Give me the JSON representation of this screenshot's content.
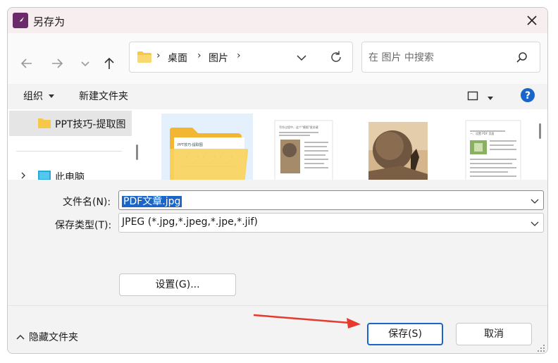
{
  "window": {
    "title": "另存为"
  },
  "nav": {
    "back_icon": "arrow-left-icon",
    "forward_icon": "arrow-right-icon",
    "recent_icon": "chevron-down-icon",
    "up_icon": "arrow-up-icon",
    "breadcrumb": [
      "桌面",
      "图片"
    ],
    "refresh_icon": "refresh-icon"
  },
  "search": {
    "placeholder": "在 图片 中搜索"
  },
  "toolbar": {
    "organize_label": "组织",
    "new_folder_label": "新建文件夹"
  },
  "sidebar": {
    "items": [
      {
        "label": "PPT技巧-提取图",
        "icon": "folder-icon",
        "selected": true
      },
      {
        "label": "此电脑",
        "icon": "computer-icon",
        "selected": false
      }
    ]
  },
  "thumb_text": {
    "card_title": "PPT技巧-提取图",
    "doc1_title": "写作过程中，这个\"模图\"很关键",
    "doc2_title": "一、设置 PDF 页面"
  },
  "form": {
    "filename_label": "文件名(N):",
    "filename_value": "PDF文章.jpg",
    "filetype_label": "保存类型(T):",
    "filetype_value": "JPEG (*.jpg,*.jpeg,*.jpe,*.jif)",
    "settings_label": "设置(G)..."
  },
  "footer": {
    "hide_folders_label": "隐藏文件夹",
    "save_label": "保存(S)",
    "cancel_label": "取消"
  },
  "colors": {
    "accent": "#1a66c8",
    "folder": "#f6c84a",
    "arrow_annotation": "#e63a2e"
  }
}
